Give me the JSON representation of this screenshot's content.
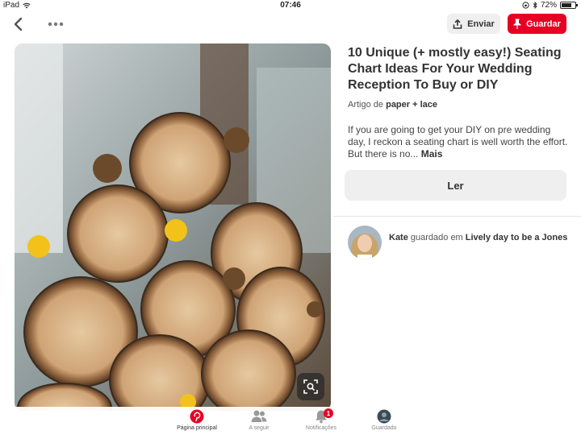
{
  "status_bar": {
    "device": "iPad",
    "time": "07:46",
    "battery": "72%",
    "battery_level": 0.72
  },
  "toolbar": {
    "send_label": "Enviar",
    "save_label": "Guardar"
  },
  "pin": {
    "title": "10 Unique (+ mostly easy!) Seating Chart Ideas For Your Wedding Reception To Buy or DIY",
    "article_prefix": "Artigo de ",
    "source": "paper + lace",
    "description": "If you are going to get your DIY on pre wedding day, I reckon a seating chart is well worth the effort. But there is no...",
    "more_label": "Mais",
    "read_label": "Ler"
  },
  "saved_by": {
    "user": "Kate",
    "action": " guardado em ",
    "board": "Lively day to be a Jones"
  },
  "tabs": [
    {
      "label": "Página principal",
      "icon": "pinterest-logo-icon",
      "active": true
    },
    {
      "label": "A seguir",
      "icon": "people-icon",
      "active": false
    },
    {
      "label": "Notificações",
      "icon": "bell-icon",
      "active": false,
      "badge": "1"
    },
    {
      "label": "Guardado",
      "icon": "profile-avatar-icon",
      "active": false
    }
  ],
  "colors": {
    "accent": "#e60023",
    "button_gray": "#efefef"
  }
}
